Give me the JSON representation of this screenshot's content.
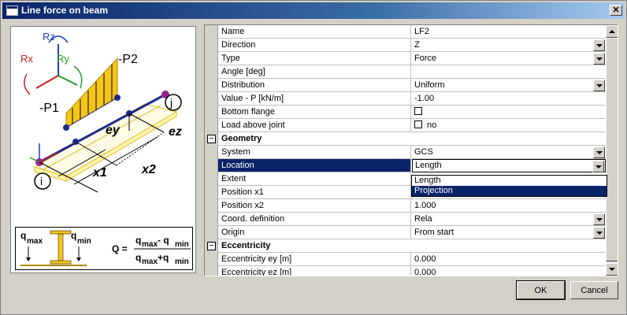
{
  "window": {
    "title": "Line force on beam",
    "close_glyph": "✕"
  },
  "diagram": {
    "labels": {
      "Rz": "Rz",
      "Rx": "Rx",
      "Ry": "Ry",
      "P2": "-P2",
      "P1": "-P1",
      "j": "j",
      "i": "i",
      "ey": "ey",
      "ez": "ez",
      "x1": "x1",
      "x2": "x2"
    },
    "formula": {
      "qmax": "q",
      "qmax_sub": "max",
      "qmin": "q",
      "qmin_sub": "min",
      "Q": "Q =",
      "num": "q",
      "num_sub1": "max",
      "num_mid": " - q",
      "num_sub2": "min",
      "den": "q",
      "den_sub1": "max",
      "den_mid": " +q",
      "den_sub2": "min"
    }
  },
  "properties": {
    "rows": [
      {
        "name": "Name",
        "value": "LF2"
      },
      {
        "name": "Direction",
        "value": "Z",
        "dropdown": true
      },
      {
        "name": "Type",
        "value": "Force",
        "dropdown": true
      },
      {
        "name": "Angle [deg]",
        "value": ""
      },
      {
        "name": "Distribution",
        "value": "Uniform",
        "dropdown": true
      },
      {
        "name": "Value - P [kN/m]",
        "value": "-1.00"
      },
      {
        "name": "Bottom flange",
        "value": "",
        "checkbox": true
      },
      {
        "name": "Load above joint",
        "value": "no",
        "checkbox": true
      },
      {
        "name": "Geometry",
        "category": true,
        "expander": "−"
      },
      {
        "name": "System",
        "value": "GCS",
        "dropdown": true
      },
      {
        "name": "Location",
        "value": "Length",
        "dropdown": true,
        "selected": true
      },
      {
        "name": "Extent",
        "value": ""
      },
      {
        "name": "Position x1",
        "value": ""
      },
      {
        "name": "Position x2",
        "value": "1.000"
      },
      {
        "name": "Coord. definition",
        "value": "Rela",
        "dropdown": true
      },
      {
        "name": "Origin",
        "value": "From start",
        "dropdown": true
      },
      {
        "name": "Eccentricity",
        "category": true,
        "expander": "−"
      },
      {
        "name": "Eccentricity ey [m]",
        "value": "0.000"
      },
      {
        "name": "Eccentricity ez [m]",
        "value": "0.000"
      }
    ]
  },
  "location_dropdown": {
    "options": [
      "Length",
      "Projection"
    ],
    "highlighted": "Projection"
  },
  "buttons": {
    "ok": "OK",
    "cancel": "Cancel"
  },
  "colors": {
    "selection": "#0a246a",
    "load_fill": "#f5c518",
    "beam": "#1f2a8a",
    "node_end": "#a0208f"
  }
}
